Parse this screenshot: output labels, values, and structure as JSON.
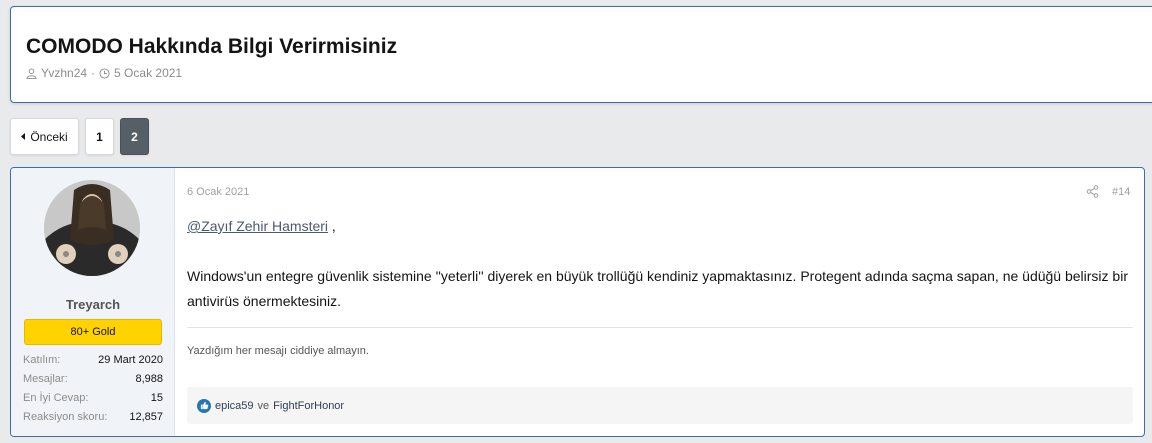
{
  "thread": {
    "title": "COMODO Hakkında Bilgi Verirmisiniz",
    "author": "Yvzhn24",
    "separator": "·",
    "date": "5 Ocak 2021"
  },
  "pagination": {
    "prev_label": "Önceki",
    "pages": [
      "1",
      "2"
    ],
    "current_page": "2"
  },
  "post": {
    "user": {
      "name": "Treyarch",
      "rank": "80+ Gold",
      "stats": [
        {
          "label": "Katılım:",
          "value": "29 Mart 2020"
        },
        {
          "label": "Mesajlar:",
          "value": "8,988"
        },
        {
          "label": "En İyi Cevap:",
          "value": "15"
        },
        {
          "label": "Reaksiyon skoru:",
          "value": "12,857"
        }
      ]
    },
    "date": "6 Ocak 2021",
    "number": "#14",
    "mention": "@Zayıf Zehir Hamsteri",
    "mention_suffix": " ,",
    "body": "Windows'un entegre güvenlik sistemine ''yeterli'' diyerek en büyük trollüğü kendiniz yapmaktasınız. Protegent adında saçma sapan, ne üdüğü belirsiz bir antivirüs önermektesiniz.",
    "signature": "Yazdığım her mesajı ciddiye almayın.",
    "reactions": {
      "user1": "epica59",
      "connector": "ve",
      "user2": "FightForHonor"
    }
  },
  "icons": {
    "author": "user-icon",
    "date": "clock-icon",
    "prev": "caret-left-icon",
    "share": "share-icon",
    "reaction": "like-icon"
  },
  "colors": {
    "accent_border": "#3b6fa8",
    "rank_bg": "#ffd200",
    "active_page": "#565e66",
    "like": "#2577b1"
  }
}
